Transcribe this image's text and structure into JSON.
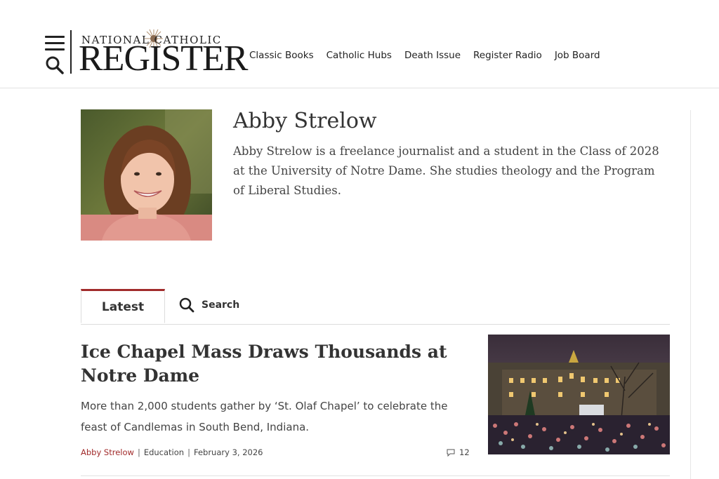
{
  "header": {
    "logo_top": "NATIONAL CATHOLIC",
    "logo_main": "REGISTER",
    "nav": [
      "Classic Books",
      "Catholic Hubs",
      "Death Issue",
      "Register Radio",
      "Job Board"
    ]
  },
  "author": {
    "name": "Abby Strelow",
    "bio": "Abby Strelow is a freelance journalist and a student in the Class of 2028 at the University of Notre Dame. She studies theology and the Program of Liberal Studies."
  },
  "tabs": {
    "latest": "Latest",
    "search": "Search"
  },
  "article": {
    "title": "Ice Chapel Mass Draws Thousands at Notre Dame",
    "summary": "More than 2,000 students gather by ‘St. Olaf Chapel’ to celebrate the feast of Candlemas in South Bend, Indiana.",
    "author": "Abby Strelow",
    "category": "Education",
    "date": "February 3, 2026",
    "comments": "12"
  },
  "colors": {
    "accent": "#a12b2b",
    "text": "#333333",
    "rule": "#dddddd"
  }
}
